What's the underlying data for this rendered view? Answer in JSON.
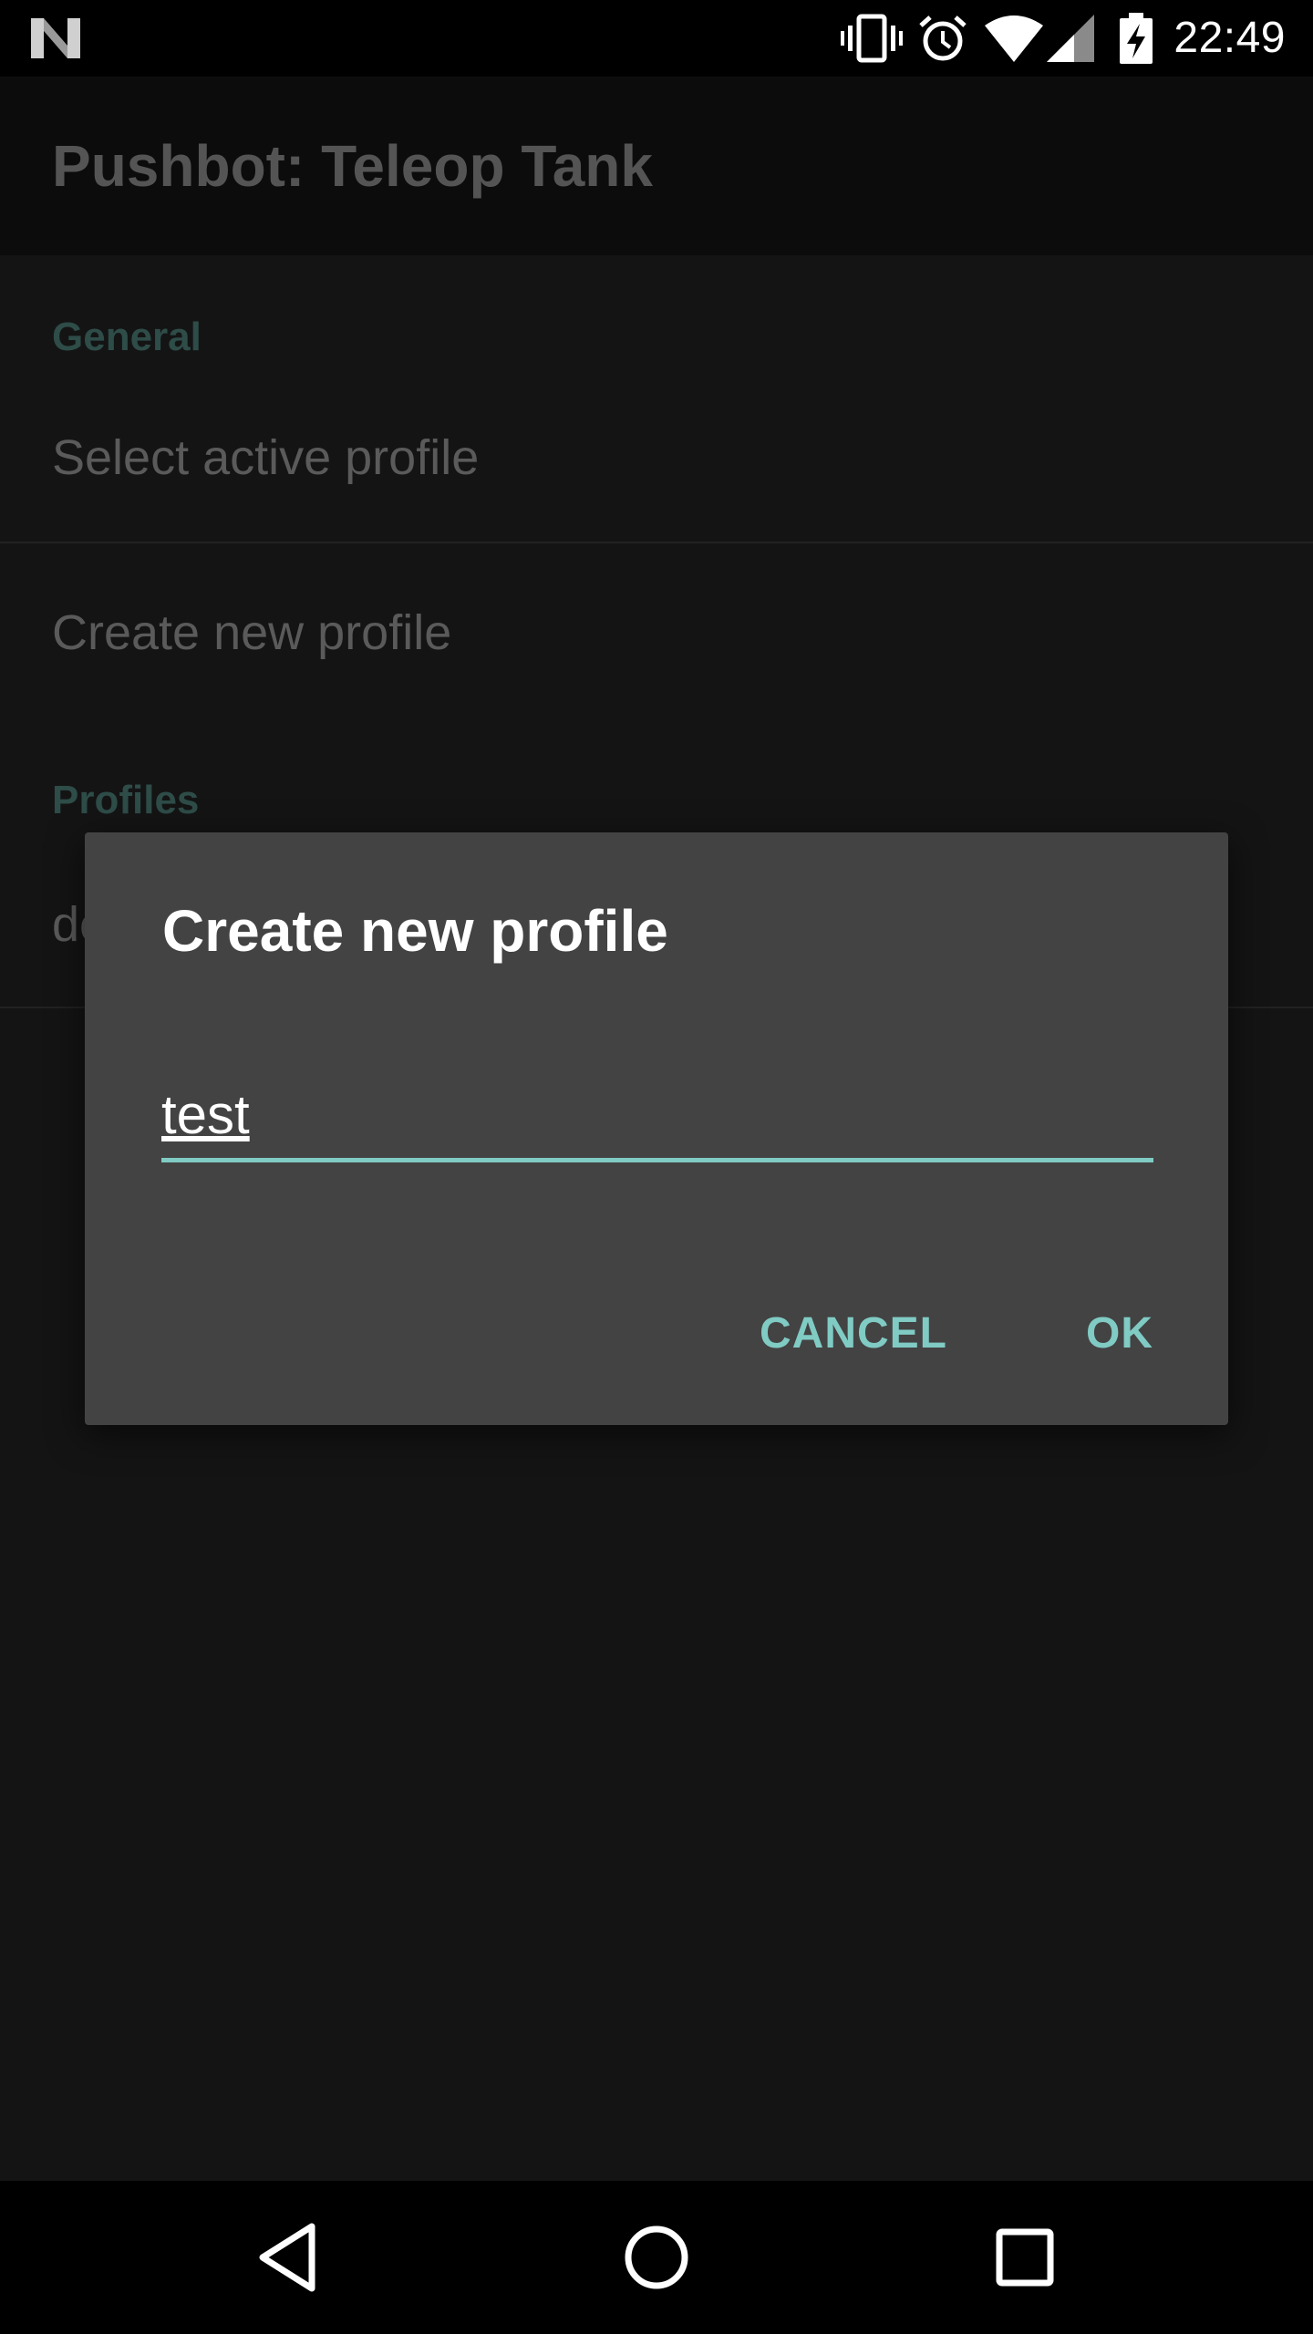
{
  "status_bar": {
    "time": "22:49",
    "icons": [
      "n-logo-icon",
      "vibrate-icon",
      "alarm-icon",
      "wifi-icon",
      "signal-icon",
      "battery-charging-icon"
    ]
  },
  "app_bar": {
    "title": "Pushbot: Teleop Tank"
  },
  "preferences": {
    "general_header": "General",
    "select_active_profile": "Select active profile",
    "create_new_profile": "Create new profile",
    "profiles_header": "Profiles",
    "profile_item_partial": "de"
  },
  "dialog": {
    "title": "Create new profile",
    "input_value": "test",
    "cancel_label": "CANCEL",
    "ok_label": "OK"
  },
  "nav_bar": {
    "icons": [
      "back-icon",
      "home-icon",
      "recents-icon"
    ]
  },
  "colors": {
    "accent": "#80cbc4",
    "dialog_bg": "#434343",
    "background": "#141414"
  }
}
